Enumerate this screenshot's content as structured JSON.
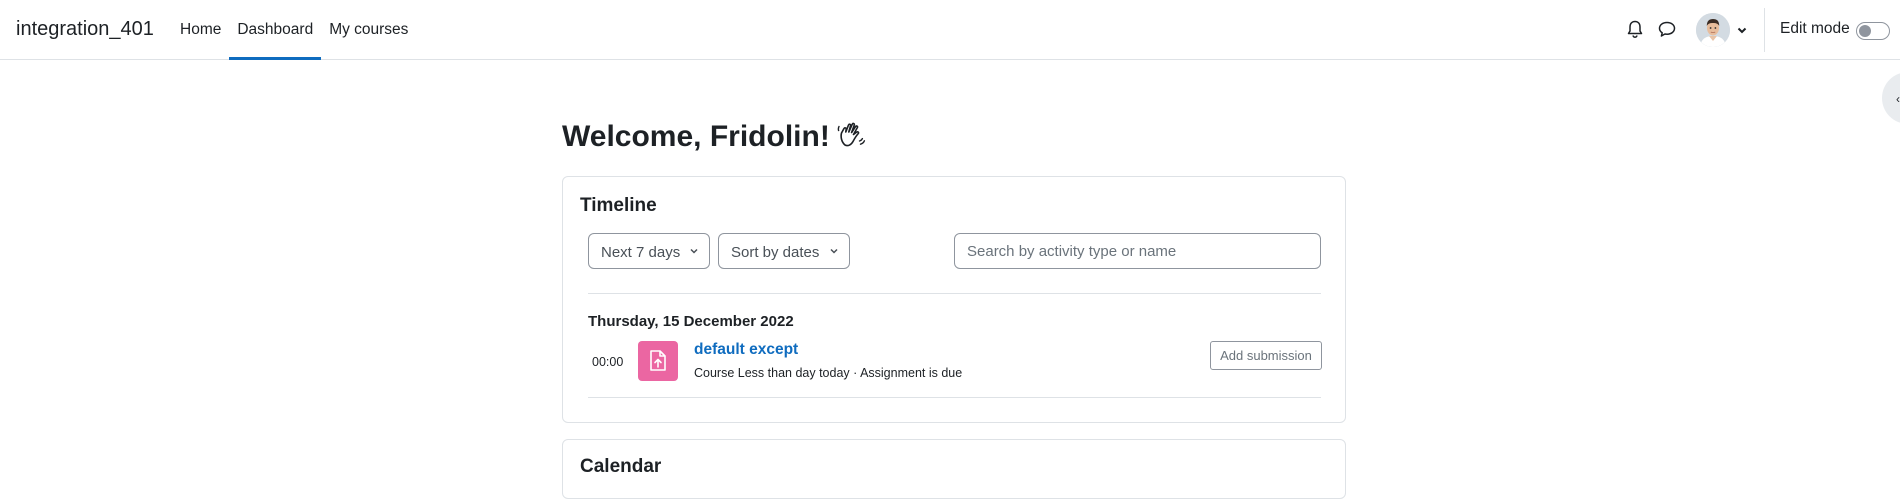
{
  "brand": "integration_401",
  "nav": {
    "items": [
      {
        "label": "Home"
      },
      {
        "label": "Dashboard",
        "active": true
      },
      {
        "label": "My courses"
      }
    ]
  },
  "header": {
    "edit_mode_label": "Edit mode",
    "edit_mode_on": false,
    "icons": [
      "bell-icon",
      "chat-icon",
      "chevron-down-icon"
    ]
  },
  "welcome": {
    "title": "Welcome, Fridolin!",
    "emoji_icon": "waving-hand-icon"
  },
  "timeline": {
    "title": "Timeline",
    "filter_label": "Next 7 days",
    "sort_label": "Sort by dates",
    "search_placeholder": "Search by activity type or name",
    "groups": [
      {
        "date": "Thursday, 15 December 2022",
        "items": [
          {
            "time": "00:00",
            "name": "default except",
            "meta": "Course Less than day today · Assignment is due",
            "action_label": "Add submission",
            "icon": "assignment-icon",
            "icon_color": "#eb66a2"
          }
        ]
      }
    ]
  },
  "calendar": {
    "title": "Calendar"
  },
  "colors": {
    "accent": "#0f6cbf",
    "assignment": "#eb66a2",
    "text": "#1d2125",
    "border": "#dee2e6"
  }
}
